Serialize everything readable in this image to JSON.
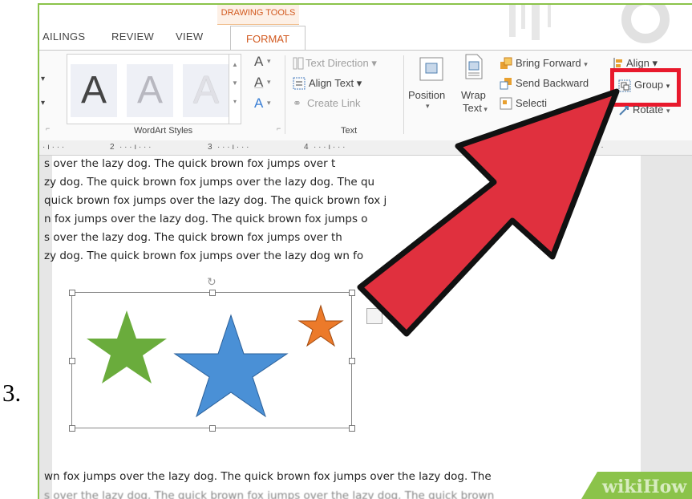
{
  "step_number": "3.",
  "ribbon": {
    "context_tab": "DRAWING TOOLS",
    "tabs": [
      "AILINGS",
      "REVIEW",
      "VIEW"
    ],
    "active_tab": "FORMAT",
    "wordart": {
      "letters": [
        "A",
        "A",
        "A"
      ],
      "group_label": "WordArt Styles",
      "fill_glyph": "A",
      "outline_glyph": "A",
      "effect_glyph": "A"
    },
    "text_group": {
      "text_direction": "Text Direction",
      "align_text": "Align Text",
      "create_link": "Create Link",
      "group_label": "Text"
    },
    "arrange": {
      "position": "Position",
      "wrap": "Wrap",
      "wrap_text": "Text",
      "bring_forward": "Bring Forward",
      "send_backward": "Send Backward",
      "selection": "Selecti",
      "align": "Align",
      "group": "Group",
      "rotate": "Rotate"
    }
  },
  "ruler": [
    "2",
    "3",
    "4"
  ],
  "document": {
    "lines": [
      "s over the lazy dog. The quick brown fox jumps over t",
      "zy dog. The quick brown fox jumps over the lazy dog. The qu",
      " quick brown fox jumps over the lazy dog. The quick brown fox j",
      "n fox jumps over the lazy dog.  The quick brown fox jumps o",
      "s over the lazy dog. The quick brown fox jumps over th",
      "zy dog. The quick brown fox jumps over the lazy dog        wn fo",
      "wn fox jumps over the lazy dog.  The quick brown fox jumps over the lazy dog.  The",
      "s over the lazy dog. The quick brown fox jumps over the lazy dog. The quick brown"
    ]
  },
  "colors": {
    "arrow": "#e0303e",
    "highlight": "#e8192c",
    "star_green": "#6aac3c",
    "star_blue": "#4a90d6",
    "star_orange": "#ec7a2a",
    "accent": "#d25a20"
  },
  "watermark": "wikiHow"
}
